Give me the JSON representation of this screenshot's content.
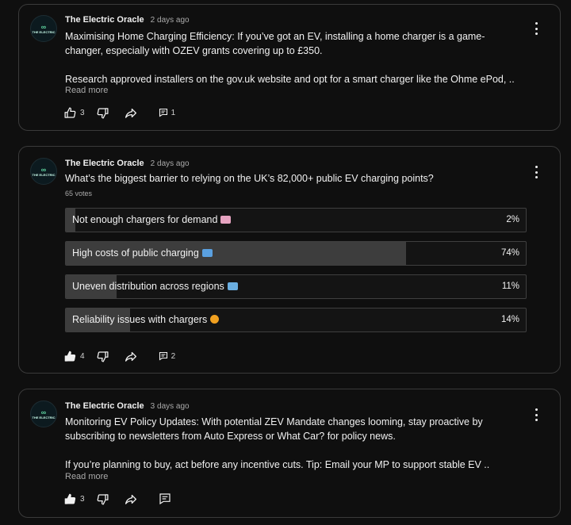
{
  "posts": [
    {
      "author": "The Electric Oracle",
      "avatar_mark": "∞",
      "avatar_text": "THE ELECTRIC",
      "time": "2 days ago",
      "lines": [
        "Maximising Home Charging Efficiency: If you’ve got an EV, installing a home charger is a game-",
        "changer, especially with OZEV grants covering up to £350.",
        "",
        "Research approved installers on the gov.uk website and opt for a smart charger like the Ohme ePod, .."
      ],
      "read_more": "Read more",
      "likes": "3",
      "comments": "1"
    },
    {
      "author": "The Electric Oracle",
      "avatar_mark": "∞",
      "avatar_text": "THE ELECTRIC",
      "time": "2 days ago",
      "question": "What’s the biggest barrier to relying on the UK’s 82,000+ public EV charging points?",
      "votes": "65 votes",
      "options": [
        {
          "label": "Not enough chargers for demand",
          "emoji": "chart-decreasing-emoji",
          "emoji_color": "#e6a3c0",
          "percent": "2%",
          "fraction": 0.02
        },
        {
          "label": "High costs of public charging",
          "emoji": "credit-card-emoji",
          "emoji_color": "#5aa0e0",
          "percent": "74%",
          "fraction": 0.74
        },
        {
          "label": "Uneven distribution across regions",
          "emoji": "map-emoji",
          "emoji_color": "#6aaee0",
          "percent": "11%",
          "fraction": 0.11
        },
        {
          "label": "Reliability issues with chargers",
          "emoji": "sad-face-emoji",
          "emoji_color": "#f0a020",
          "percent": "14%",
          "fraction": 0.14
        }
      ],
      "likes": "4",
      "comments": "2"
    },
    {
      "author": "The Electric Oracle",
      "avatar_mark": "∞",
      "avatar_text": "THE ELECTRIC",
      "time": "3 days ago",
      "lines": [
        "Monitoring EV Policy Updates: With potential ZEV Mandate changes looming, stay proactive by",
        "subscribing to newsletters from Auto Express or What Car? for policy news.",
        "",
        "If you’re planning to buy, act before any incentive cuts. Tip: Email your MP to support stable EV .."
      ],
      "read_more": "Read more",
      "likes": "3",
      "comments": ""
    }
  ]
}
